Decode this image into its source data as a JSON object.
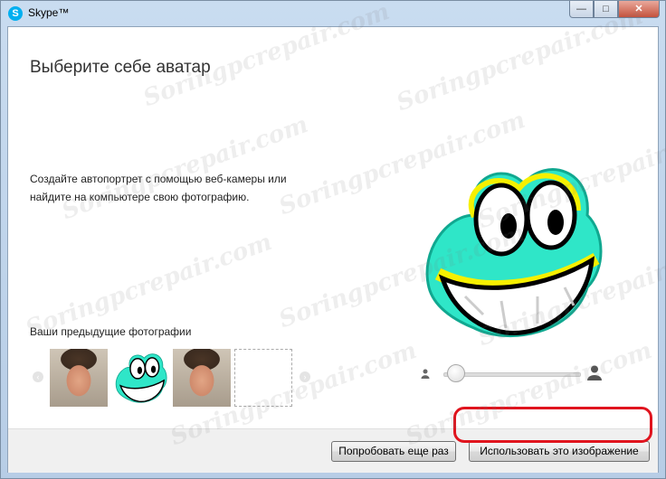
{
  "window": {
    "title": "Skype™",
    "minimize_glyph": "—",
    "maximize_glyph": "□",
    "close_glyph": "✕"
  },
  "main": {
    "heading": "Выберите себе аватар",
    "description": "Создайте автопортрет с помощью веб-камеры или найдите на компьютере свою фотографию.",
    "previous_label": "Ваши предыдущие фотографии",
    "thumbnails": [
      "person-photo",
      "frog-avatar",
      "person-photo",
      "empty-slot"
    ],
    "zoom_level": 0.05
  },
  "footer": {
    "retry_label": "Попробовать еще раз",
    "use_label": "Использовать это изображение"
  },
  "watermark": "Soringpcrepair.com",
  "colors": {
    "accent": "#00aff0",
    "highlight": "#e0141e",
    "frog_body": "#2fe6c8",
    "frog_yellow": "#f6f000"
  }
}
